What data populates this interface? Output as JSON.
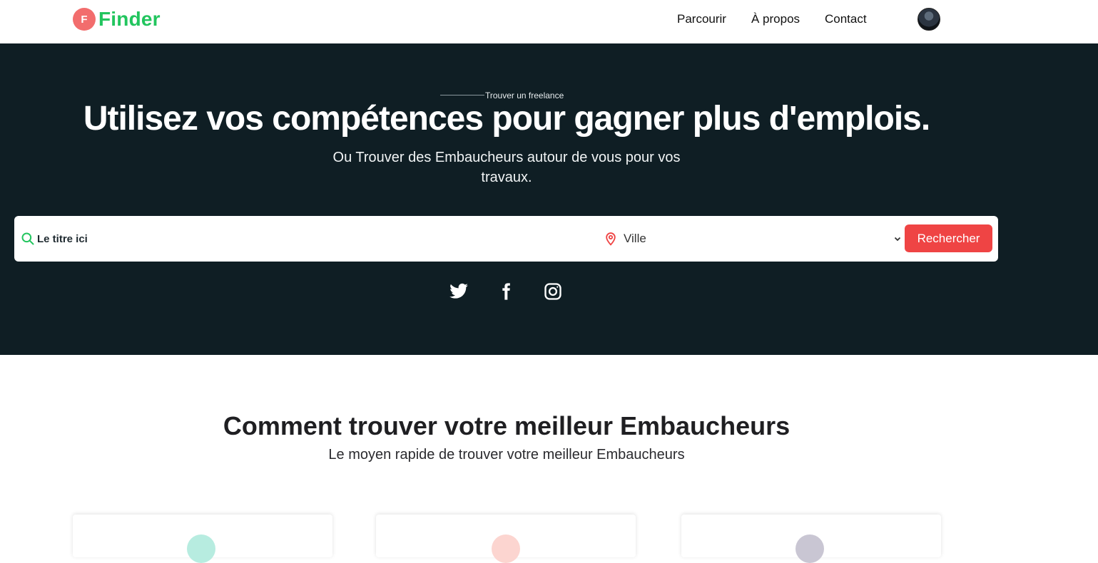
{
  "brand": {
    "badge": "F",
    "name": "Finder",
    "badge_color": "#f26d6d",
    "name_color": "#22c55e"
  },
  "nav": {
    "items": [
      "Parcourir",
      "À propos",
      "Contact"
    ]
  },
  "hero": {
    "eyebrow": "Trouver un freelance",
    "title": "Utilisez vos compétences pour gagner plus d'emplois.",
    "subtitle": "Ou Trouver des Embaucheurs autour de vous pour vos travaux.",
    "background": "#0f1e24"
  },
  "search": {
    "title_placeholder": "Le titre ici",
    "city_value": "Ville",
    "button_label": "Rechercher",
    "button_color": "#ef4444"
  },
  "social": [
    "twitter-icon",
    "facebook-icon",
    "instagram-icon"
  ],
  "section": {
    "title": "Comment trouver votre meilleur Embaucheurs",
    "subtitle": "Le moyen rapide de trouver votre meilleur Embaucheurs"
  }
}
